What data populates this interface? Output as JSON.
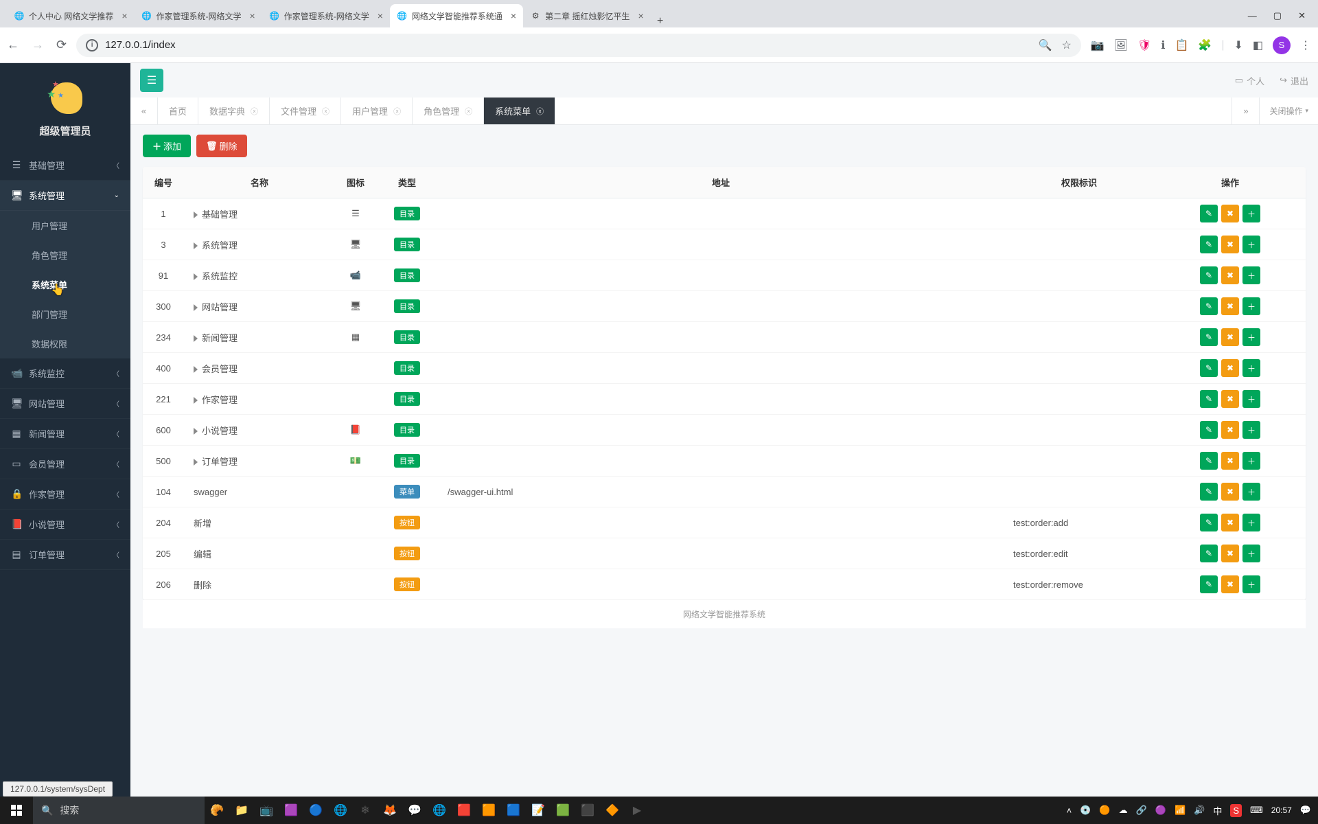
{
  "browser": {
    "tabs": [
      {
        "title": "个人中心 网络文学推荐",
        "active": false
      },
      {
        "title": "作家管理系统-网络文学",
        "active": false
      },
      {
        "title": "作家管理系统-网络文学",
        "active": false
      },
      {
        "title": "网络文学智能推荐系统通",
        "active": true
      },
      {
        "title": "第二章 摇红烛影忆平生",
        "active": false
      }
    ],
    "url": "127.0.0.1/index",
    "status_url": "127.0.0.1/system/sysDept",
    "avatar_letter": "S"
  },
  "sidebar": {
    "admin_label": "超级管理员",
    "items": [
      {
        "label": "基础管理"
      },
      {
        "label": "系统管理",
        "expanded": true,
        "children": [
          {
            "label": "用户管理"
          },
          {
            "label": "角色管理"
          },
          {
            "label": "系统菜单",
            "current": true
          },
          {
            "label": "部门管理"
          },
          {
            "label": "数据权限"
          }
        ]
      },
      {
        "label": "系统监控"
      },
      {
        "label": "网站管理"
      },
      {
        "label": "新闻管理"
      },
      {
        "label": "会员管理"
      },
      {
        "label": "作家管理"
      },
      {
        "label": "小说管理"
      },
      {
        "label": "订单管理"
      }
    ]
  },
  "topbar": {
    "personal": "个人",
    "logout": "退出"
  },
  "tabs": {
    "home": "首页",
    "items": [
      {
        "label": "数据字典"
      },
      {
        "label": "文件管理"
      },
      {
        "label": "用户管理"
      },
      {
        "label": "角色管理"
      },
      {
        "label": "系统菜单",
        "active": true
      }
    ],
    "close_ops": "关闭操作"
  },
  "buttons": {
    "add": "添加",
    "delete": "删除"
  },
  "table": {
    "headers": {
      "id": "编号",
      "name": "名称",
      "icon": "图标",
      "type": "类型",
      "url": "地址",
      "perm": "权限标识",
      "ops": "操作"
    },
    "type_labels": {
      "dir": "目录",
      "menu": "菜单",
      "btn": "按钮"
    },
    "rows": [
      {
        "id": "1",
        "name": "基础管理",
        "icon": "bars",
        "type": "dir",
        "url": "",
        "perm": "",
        "expandable": true
      },
      {
        "id": "3",
        "name": "系统管理",
        "icon": "desktop",
        "type": "dir",
        "url": "",
        "perm": "",
        "expandable": true
      },
      {
        "id": "91",
        "name": "系统监控",
        "icon": "video",
        "type": "dir",
        "url": "",
        "perm": "",
        "expandable": true
      },
      {
        "id": "300",
        "name": "网站管理",
        "icon": "desktop",
        "type": "dir",
        "url": "",
        "perm": "",
        "expandable": true
      },
      {
        "id": "234",
        "name": "新闻管理",
        "icon": "news",
        "type": "dir",
        "url": "",
        "perm": "",
        "expandable": true
      },
      {
        "id": "400",
        "name": "会员管理",
        "icon": "",
        "type": "dir",
        "url": "",
        "perm": "",
        "expandable": true
      },
      {
        "id": "221",
        "name": "作家管理",
        "icon": "",
        "type": "dir",
        "url": "",
        "perm": "",
        "expandable": true
      },
      {
        "id": "600",
        "name": "小说管理",
        "icon": "book",
        "type": "dir",
        "url": "",
        "perm": "",
        "expandable": true
      },
      {
        "id": "500",
        "name": "订单管理",
        "icon": "money",
        "type": "dir",
        "url": "",
        "perm": "",
        "expandable": true
      },
      {
        "id": "104",
        "name": "swagger",
        "icon": "",
        "type": "menu",
        "url": "/swagger-ui.html",
        "perm": "",
        "indent": true
      },
      {
        "id": "204",
        "name": "新增",
        "icon": "",
        "type": "btn",
        "url": "",
        "perm": "test:order:add",
        "indent": true
      },
      {
        "id": "205",
        "name": "编辑",
        "icon": "",
        "type": "btn",
        "url": "",
        "perm": "test:order:edit",
        "indent": true
      },
      {
        "id": "206",
        "name": "删除",
        "icon": "",
        "type": "btn",
        "url": "",
        "perm": "test:order:remove",
        "indent": true
      }
    ]
  },
  "footer": "网络文学智能推荐系统",
  "taskbar": {
    "search_placeholder": "搜索",
    "time": "20:57",
    "ime": "中"
  }
}
